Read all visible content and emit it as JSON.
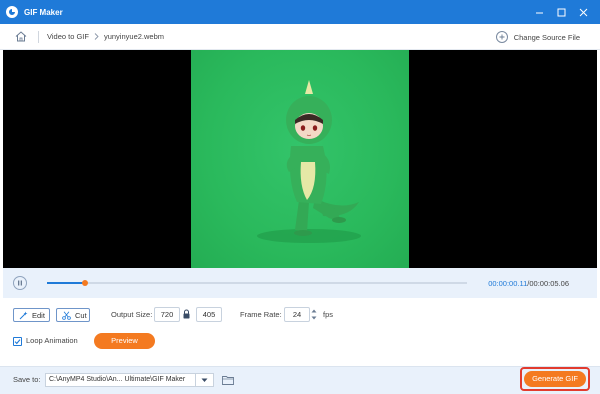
{
  "window": {
    "title": "GIF Maker",
    "controls": [
      "minimize-icon",
      "maximize-icon",
      "close-icon"
    ]
  },
  "breadcrumb": {
    "home_icon": "home-icon",
    "section": "Video to GIF",
    "file": "yunyinyue2.webm",
    "change_source_label": "Change Source File"
  },
  "player": {
    "pause_icon": "pause-icon",
    "progress_fraction": 0.09,
    "current_time": "00:00:00.11",
    "separator": "/",
    "total_time": "00:00:05.06"
  },
  "settings": {
    "edit_label": "Edit",
    "cut_label": "Cut",
    "output_size_label": "Output Size:",
    "width_value": "720",
    "height_value": "405",
    "frame_rate_label": "Frame Rate:",
    "frame_rate_value": "24",
    "fps_label": "fps",
    "loop_label": "Loop Animation",
    "loop_checked": true,
    "preview_label": "Preview"
  },
  "footer": {
    "save_to_label": "Save to:",
    "save_path": "C:\\AnyMP4 Studio\\An... Ultimate\\GIF Maker",
    "generate_label": "Generate GIF"
  },
  "colors": {
    "title_bar": "#1f7ad8",
    "accent_orange": "#f47a20",
    "highlight_red": "#e23b2e",
    "video_green": "#2ab95c"
  }
}
